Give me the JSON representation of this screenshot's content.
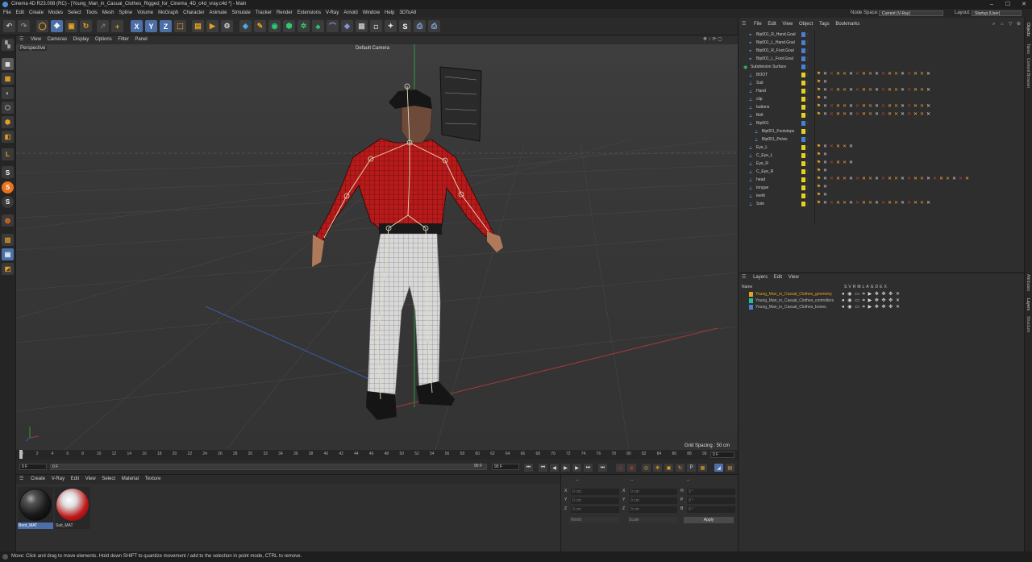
{
  "app": {
    "title": "Cinema 4D R23.008 (RC) - [Young_Man_in_Casual_Clothes_Rigged_for_Cinema_4D_c4d_vray.c4d *] - Main"
  },
  "menubar": {
    "items": [
      "File",
      "Edit",
      "Create",
      "Modes",
      "Select",
      "Tools",
      "Mesh",
      "Spline",
      "Volume",
      "MoGraph",
      "Character",
      "Animate",
      "Simulate",
      "Tracker",
      "Render",
      "Extensions",
      "V-Ray",
      "Arnold",
      "Window",
      "Help",
      "3DToAll"
    ],
    "node_space_label": "Node Space:",
    "node_space_value": "Current (V-Ray)",
    "layout_label": "Layout:",
    "layout_value": "Startup (User)"
  },
  "viewport": {
    "menu": [
      "View",
      "Cameras",
      "Display",
      "Options",
      "Filter",
      "Panel"
    ],
    "view_name": "Perspective",
    "camera": "Default Camera",
    "grid_spacing": "Grid Spacing : 50 cm"
  },
  "timeline": {
    "ticks": [
      "0",
      "2",
      "4",
      "6",
      "8",
      "10",
      "12",
      "14",
      "16",
      "18",
      "20",
      "22",
      "24",
      "26",
      "28",
      "30",
      "32",
      "34",
      "36",
      "38",
      "40",
      "42",
      "44",
      "46",
      "48",
      "50",
      "52",
      "54",
      "56",
      "58",
      "60",
      "62",
      "64",
      "66",
      "68",
      "70",
      "72",
      "74",
      "76",
      "78",
      "80",
      "82",
      "84",
      "86",
      "88",
      "90"
    ],
    "current_frame_right": "0 F"
  },
  "playbar": {
    "start": "0 F",
    "current": "0 F",
    "end": "90 F",
    "max": "90 F"
  },
  "materials": {
    "menu": [
      "Create",
      "V-Ray",
      "Edit",
      "View",
      "Select",
      "Material",
      "Texture"
    ],
    "items": [
      {
        "name": "Boot_MAT"
      },
      {
        "name": "Suit_MAT"
      }
    ]
  },
  "coordinates": {
    "header_left": "--",
    "header_mid": "--",
    "header_right": "--",
    "rows": [
      {
        "a": "X",
        "a_val": "0 cm",
        "b": "X",
        "b_val": "0 cm",
        "c": "H",
        "c_val": "0 °"
      },
      {
        "a": "Y",
        "a_val": "0 cm",
        "b": "Y",
        "b_val": "0 cm",
        "c": "P",
        "c_val": "0 °"
      },
      {
        "a": "Z",
        "a_val": "0 cm",
        "b": "Z",
        "b_val": "0 cm",
        "c": "B",
        "c_val": "0 °"
      }
    ],
    "mode": "World",
    "scale_mode": "Scale",
    "apply_label": "Apply"
  },
  "object_manager": {
    "menu": [
      "File",
      "Edit",
      "View",
      "Object",
      "Tags",
      "Bookmarks"
    ],
    "objects": [
      {
        "name": "Bip001_R_Hand.Goal",
        "indent": 1,
        "color": "#4a7fd4",
        "tags": 0
      },
      {
        "name": "Bip001_L_Hand.Goal",
        "indent": 1,
        "color": "#4a7fd4",
        "tags": 0
      },
      {
        "name": "Bip001_R_Foot.Goal",
        "indent": 1,
        "color": "#4a7fd4",
        "tags": 0
      },
      {
        "name": "Bip001_L_Foot.Goal",
        "indent": 1,
        "color": "#4a7fd4",
        "tags": 0
      },
      {
        "name": "Subdivision Surface",
        "indent": 0,
        "color": "#4a7fd4",
        "tags": 0
      },
      {
        "name": "BOOT",
        "indent": 1,
        "color": "#e8d020",
        "tags": 18
      },
      {
        "name": "Suit",
        "indent": 1,
        "color": "#e8d020",
        "tags": 2
      },
      {
        "name": "Hand",
        "indent": 1,
        "color": "#e8d020",
        "tags": 18
      },
      {
        "name": "clip",
        "indent": 1,
        "color": "#e8d020",
        "tags": 2
      },
      {
        "name": "buttons",
        "indent": 1,
        "color": "#e8d020",
        "tags": 18
      },
      {
        "name": "Belt",
        "indent": 1,
        "color": "#e8d020",
        "tags": 18
      },
      {
        "name": "Bip001",
        "indent": 1,
        "color": "#4a7fd4",
        "tags": 0
      },
      {
        "name": "Bip001_Footsteps",
        "indent": 2,
        "color": "#e8d020",
        "tags": 0
      },
      {
        "name": "Bip001_Pelvis",
        "indent": 2,
        "color": "#4a7fd4",
        "tags": 0
      },
      {
        "name": "Eye_L",
        "indent": 1,
        "color": "#e8d020",
        "tags": 6
      },
      {
        "name": "C_Eye_L",
        "indent": 1,
        "color": "#e8d020",
        "tags": 2
      },
      {
        "name": "Eye_R",
        "indent": 1,
        "color": "#e8d020",
        "tags": 6
      },
      {
        "name": "C_Eye_R",
        "indent": 1,
        "color": "#e8d020",
        "tags": 2
      },
      {
        "name": "head",
        "indent": 1,
        "color": "#e8d020",
        "tags": 24
      },
      {
        "name": "tongue",
        "indent": 1,
        "color": "#e8d020",
        "tags": 2
      },
      {
        "name": "teeth",
        "indent": 1,
        "color": "#e8d020",
        "tags": 2
      },
      {
        "name": "Sole",
        "indent": 1,
        "color": "#e8d020",
        "tags": 18
      }
    ]
  },
  "layer_manager": {
    "menu": [
      "Layers",
      "Edit",
      "View"
    ],
    "name_col": "Name",
    "flags": [
      "S",
      "V",
      "R",
      "M",
      "L",
      "A",
      "G",
      "D",
      "E",
      "X"
    ],
    "layers": [
      {
        "name": "Young_Man_in_Casual_Clothes_geometry",
        "color": "#e8a020"
      },
      {
        "name": "Young_Man_in_Casual_Clothes_controllers",
        "color": "#20c0a0"
      },
      {
        "name": "Young_Man_in_Casual_Clothes_bones",
        "color": "#4a7fd4"
      }
    ]
  },
  "right_tabs": [
    "Objects",
    "Takes",
    "Content Browser",
    "Attributes",
    "Layers",
    "Structure"
  ],
  "status": "Move: Click and drag to move elements. Hold down SHIFT to quantize movement / add to the selection in point mode, CTRL to remove."
}
